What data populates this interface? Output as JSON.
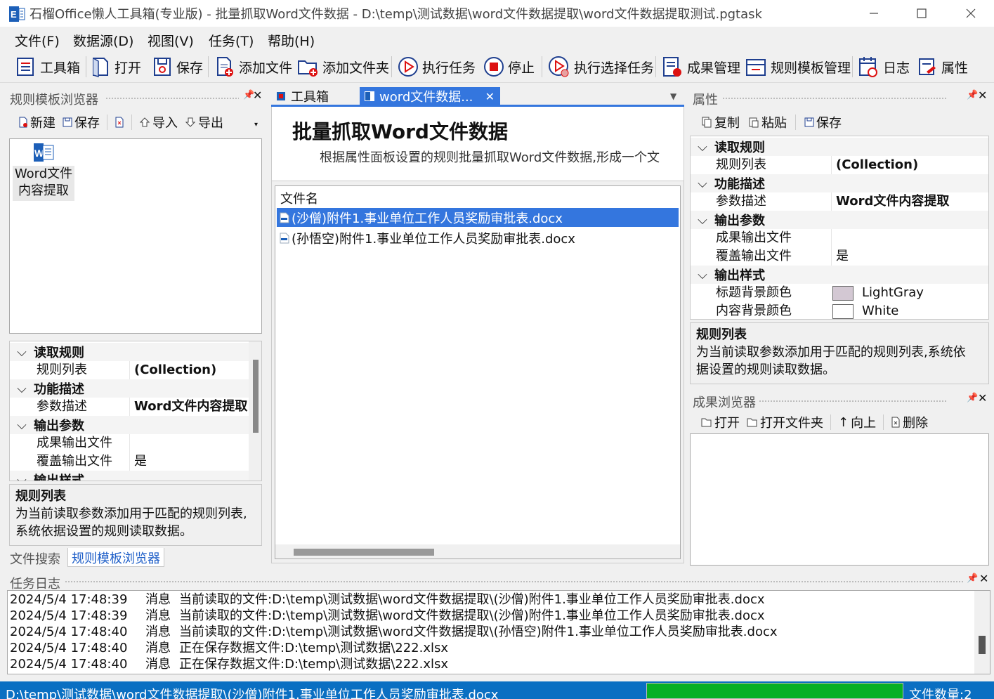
{
  "window": {
    "title": "石榴Office懒人工具箱(专业版) - 批量抓取Word文件数据 - D:\\temp\\测试数据\\word文件数据提取\\word文件数据提取测试.pgtask"
  },
  "menu": [
    "文件(F)",
    "数据源(D)",
    "视图(V)",
    "任务(T)",
    "帮助(H)"
  ],
  "toolbar": {
    "toolbox": "工具箱",
    "open": "打开",
    "save": "保存",
    "add_file": "添加文件",
    "add_folder": "添加文件夹",
    "run_task": "执行任务",
    "stop": "停止",
    "run_selected": "执行选择任务",
    "results": "成果管理",
    "templates": "规则模板管理",
    "log": "日志",
    "properties": "属性"
  },
  "left_panel": {
    "title": "规则模板浏览器",
    "toolbar": {
      "new": "新建",
      "save": "保存",
      "import": "导入",
      "export": "导出"
    },
    "template_item": {
      "line1": "Word文件",
      "line2": "内容提取"
    },
    "grid": {
      "cat1": "读取规则",
      "rule_list_label": "规则列表",
      "rule_list_value": "(Collection)",
      "cat2": "功能描述",
      "param_desc_label": "参数描述",
      "param_desc_value": "Word文件内容提取",
      "cat3": "输出参数",
      "output_file_label": "成果输出文件",
      "output_file_value": "",
      "overwrite_label": "覆盖输出文件",
      "overwrite_value": "是",
      "cat4": "输出样式"
    },
    "desc_title": "规则列表",
    "desc_text_line1": "为当前读取参数添加用于匹配的规则列表,",
    "desc_text_line2": "系统依据设置的规则读取数据。",
    "bottom_tabs": [
      "文件搜索",
      "规则模板浏览器"
    ]
  },
  "center": {
    "tabs": [
      "工具箱",
      "word文件数据..."
    ],
    "header_title": "批量抓取Word文件数据",
    "header_desc": "根据属性面板设置的规则批量抓取Word文件数据,形成一个文",
    "file_list": {
      "column": "文件名",
      "files": [
        "(沙僧)附件1.事业单位工作人员奖励审批表.docx",
        "(孙悟空)附件1.事业单位工作人员奖励审批表.docx"
      ]
    }
  },
  "right_panel": {
    "title": "属性",
    "toolbar": {
      "copy": "复制",
      "paste": "粘贴",
      "save": "保存"
    },
    "grid": {
      "cat1": "读取规则",
      "rule_list_label": "规则列表",
      "rule_list_value": "(Collection)",
      "cat2": "功能描述",
      "param_desc_label": "参数描述",
      "param_desc_value": "Word文件内容提取",
      "cat3": "输出参数",
      "output_file_label": "成果输出文件",
      "output_file_value": "",
      "overwrite_label": "覆盖输出文件",
      "overwrite_value": "是",
      "cat4": "输出样式",
      "title_bg_label": "标题背景颜色",
      "title_bg_value": "LightGray",
      "title_bg_color": "#d3c8d3",
      "content_bg_label": "内容背景颜色",
      "content_bg_value": "White",
      "content_bg_color": "#ffffff"
    },
    "desc_title": "规则列表",
    "desc_text_line1": "为当前读取参数添加用于匹配的规则列表,系统依",
    "desc_text_line2": "据设置的规则读取数据。"
  },
  "results_panel": {
    "title": "成果浏览器",
    "toolbar": {
      "open": "打开",
      "open_folder": "打开文件夹",
      "up": "向上",
      "delete": "删除"
    }
  },
  "log_panel": {
    "title": "任务日志",
    "entries": [
      {
        "time": "2024/5/4 17:48:39",
        "type": "消息",
        "text": "当前读取的文件:D:\\temp\\测试数据\\word文件数据提取\\(沙僧)附件1.事业单位工作人员奖励审批表.docx"
      },
      {
        "time": "2024/5/4 17:48:39",
        "type": "消息",
        "text": "当前读取的文件:D:\\temp\\测试数据\\word文件数据提取\\(沙僧)附件1.事业单位工作人员奖励审批表.docx"
      },
      {
        "time": "2024/5/4 17:48:40",
        "type": "消息",
        "text": "当前读取的文件:D:\\temp\\测试数据\\word文件数据提取\\(孙悟空)附件1.事业单位工作人员奖励审批表.docx"
      },
      {
        "time": "2024/5/4 17:48:40",
        "type": "消息",
        "text": "正在保存数据文件:D:\\temp\\测试数据\\222.xlsx"
      },
      {
        "time": "2024/5/4 17:48:40",
        "type": "消息",
        "text": "正在保存数据文件:D:\\temp\\测试数据\\222.xlsx"
      }
    ]
  },
  "statusbar": {
    "path": "D:\\temp\\测试数据\\word文件数据提取\\(沙僧)附件1.事业单位工作人员奖励审批表.docx",
    "progress": 1.0,
    "progress_color": "#06b025",
    "file_count": "文件数量:2"
  },
  "colors": {
    "accent": "#0a6fc2",
    "selection": "#3476de",
    "app_icon": "#1c5fb8"
  }
}
